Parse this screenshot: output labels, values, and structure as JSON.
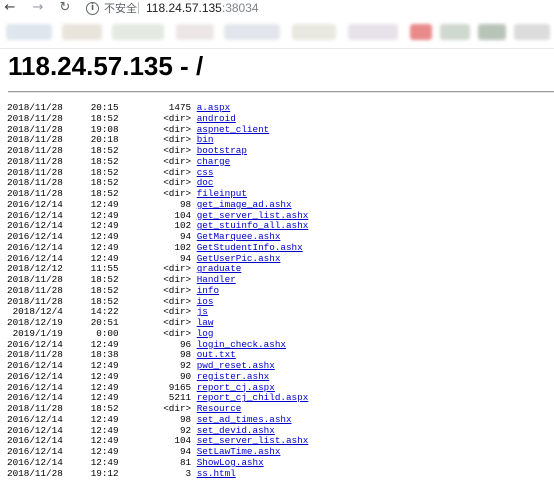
{
  "browser": {
    "back_icon": "arrow-left-icon",
    "forward_icon": "arrow-right-icon",
    "reload_icon": "reload-icon",
    "info_icon": "info-icon",
    "security_text": "不安全",
    "url_host": "118.24.57.135",
    "url_port": ":38034"
  },
  "page": {
    "title": "118.24.57.135 - /"
  },
  "listing": [
    {
      "date": "2018/11/28",
      "time": "20:15",
      "size": "1475",
      "name": "a.aspx"
    },
    {
      "date": "2018/11/28",
      "time": "18:52",
      "size": "<dir>",
      "name": "android"
    },
    {
      "date": "2018/11/28",
      "time": "19:08",
      "size": "<dir>",
      "name": "aspnet_client"
    },
    {
      "date": "2018/11/28",
      "time": "20:18",
      "size": "<dir>",
      "name": "bin"
    },
    {
      "date": "2018/11/28",
      "time": "18:52",
      "size": "<dir>",
      "name": "bootstrap"
    },
    {
      "date": "2018/11/28",
      "time": "18:52",
      "size": "<dir>",
      "name": "charge"
    },
    {
      "date": "2018/11/28",
      "time": "18:52",
      "size": "<dir>",
      "name": "css"
    },
    {
      "date": "2018/11/28",
      "time": "18:52",
      "size": "<dir>",
      "name": "doc"
    },
    {
      "date": "2018/11/28",
      "time": "18:52",
      "size": "<dir>",
      "name": "fileinput"
    },
    {
      "date": "2016/12/14",
      "time": "12:49",
      "size": "98",
      "name": "get_image_ad.ashx"
    },
    {
      "date": "2016/12/14",
      "time": "12:49",
      "size": "104",
      "name": "get_server_list.ashx"
    },
    {
      "date": "2016/12/14",
      "time": "12:49",
      "size": "102",
      "name": "get_stuinfo_all.ashx"
    },
    {
      "date": "2016/12/14",
      "time": "12:49",
      "size": "94",
      "name": "GetMarquee.ashx"
    },
    {
      "date": "2016/12/14",
      "time": "12:49",
      "size": "102",
      "name": "GetStudentInfo.ashx"
    },
    {
      "date": "2016/12/14",
      "time": "12:49",
      "size": "94",
      "name": "GetUserPic.ashx"
    },
    {
      "date": "2018/12/12",
      "time": "11:55",
      "size": "<dir>",
      "name": "graduate"
    },
    {
      "date": "2018/11/28",
      "time": "18:52",
      "size": "<dir>",
      "name": "Handler"
    },
    {
      "date": "2018/11/28",
      "time": "18:52",
      "size": "<dir>",
      "name": "info"
    },
    {
      "date": "2018/11/28",
      "time": "18:52",
      "size": "<dir>",
      "name": "ios"
    },
    {
      "date": "2018/12/4",
      "time": "14:22",
      "size": "<dir>",
      "name": "js"
    },
    {
      "date": "2018/12/19",
      "time": "20:51",
      "size": "<dir>",
      "name": "law"
    },
    {
      "date": "2019/1/19",
      "time": "0:00",
      "size": "<dir>",
      "name": "log"
    },
    {
      "date": "2016/12/14",
      "time": "12:49",
      "size": "96",
      "name": "login_check.ashx"
    },
    {
      "date": "2018/11/28",
      "time": "18:38",
      "size": "98",
      "name": "out.txt"
    },
    {
      "date": "2016/12/14",
      "time": "12:49",
      "size": "92",
      "name": "pwd_reset.ashx"
    },
    {
      "date": "2016/12/14",
      "time": "12:49",
      "size": "90",
      "name": "register.ashx"
    },
    {
      "date": "2016/12/14",
      "time": "12:49",
      "size": "9165",
      "name": "report_cj.aspx"
    },
    {
      "date": "2016/12/14",
      "time": "12:49",
      "size": "5211",
      "name": "report_cj_child.aspx"
    },
    {
      "date": "2018/11/28",
      "time": "18:52",
      "size": "<dir>",
      "name": "Resource"
    },
    {
      "date": "2016/12/14",
      "time": "12:49",
      "size": "98",
      "name": "set_ad_times.ashx"
    },
    {
      "date": "2016/12/14",
      "time": "12:49",
      "size": "92",
      "name": "set_devid.ashx"
    },
    {
      "date": "2016/12/14",
      "time": "12:49",
      "size": "104",
      "name": "set_server_list.ashx"
    },
    {
      "date": "2016/12/14",
      "time": "12:49",
      "size": "94",
      "name": "SetLawTime.ashx"
    },
    {
      "date": "2016/12/14",
      "time": "12:49",
      "size": "81",
      "name": "ShowLog.ashx"
    },
    {
      "date": "2018/11/28",
      "time": "19:12",
      "size": "3",
      "name": "ss.html"
    }
  ]
}
